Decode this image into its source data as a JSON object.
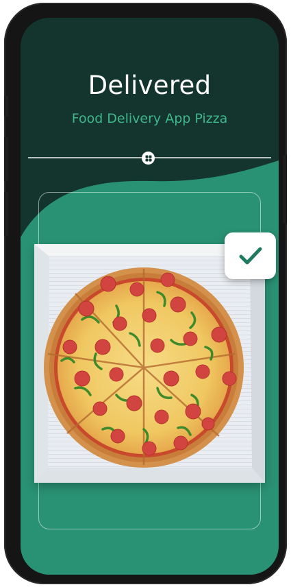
{
  "screen": {
    "title": "Delivered",
    "subtitle": "Food Delivery App Pizza"
  },
  "icons": {
    "divider_knob": "move-handle-icon",
    "check": "checkmark-icon"
  },
  "image": {
    "subject": "pizza-in-box"
  },
  "colors": {
    "background_dark": "#14352e",
    "accent_green": "#2a9274",
    "subtitle_green": "#3fb78c",
    "title_white": "#ffffff",
    "check_green": "#1f7a60"
  }
}
